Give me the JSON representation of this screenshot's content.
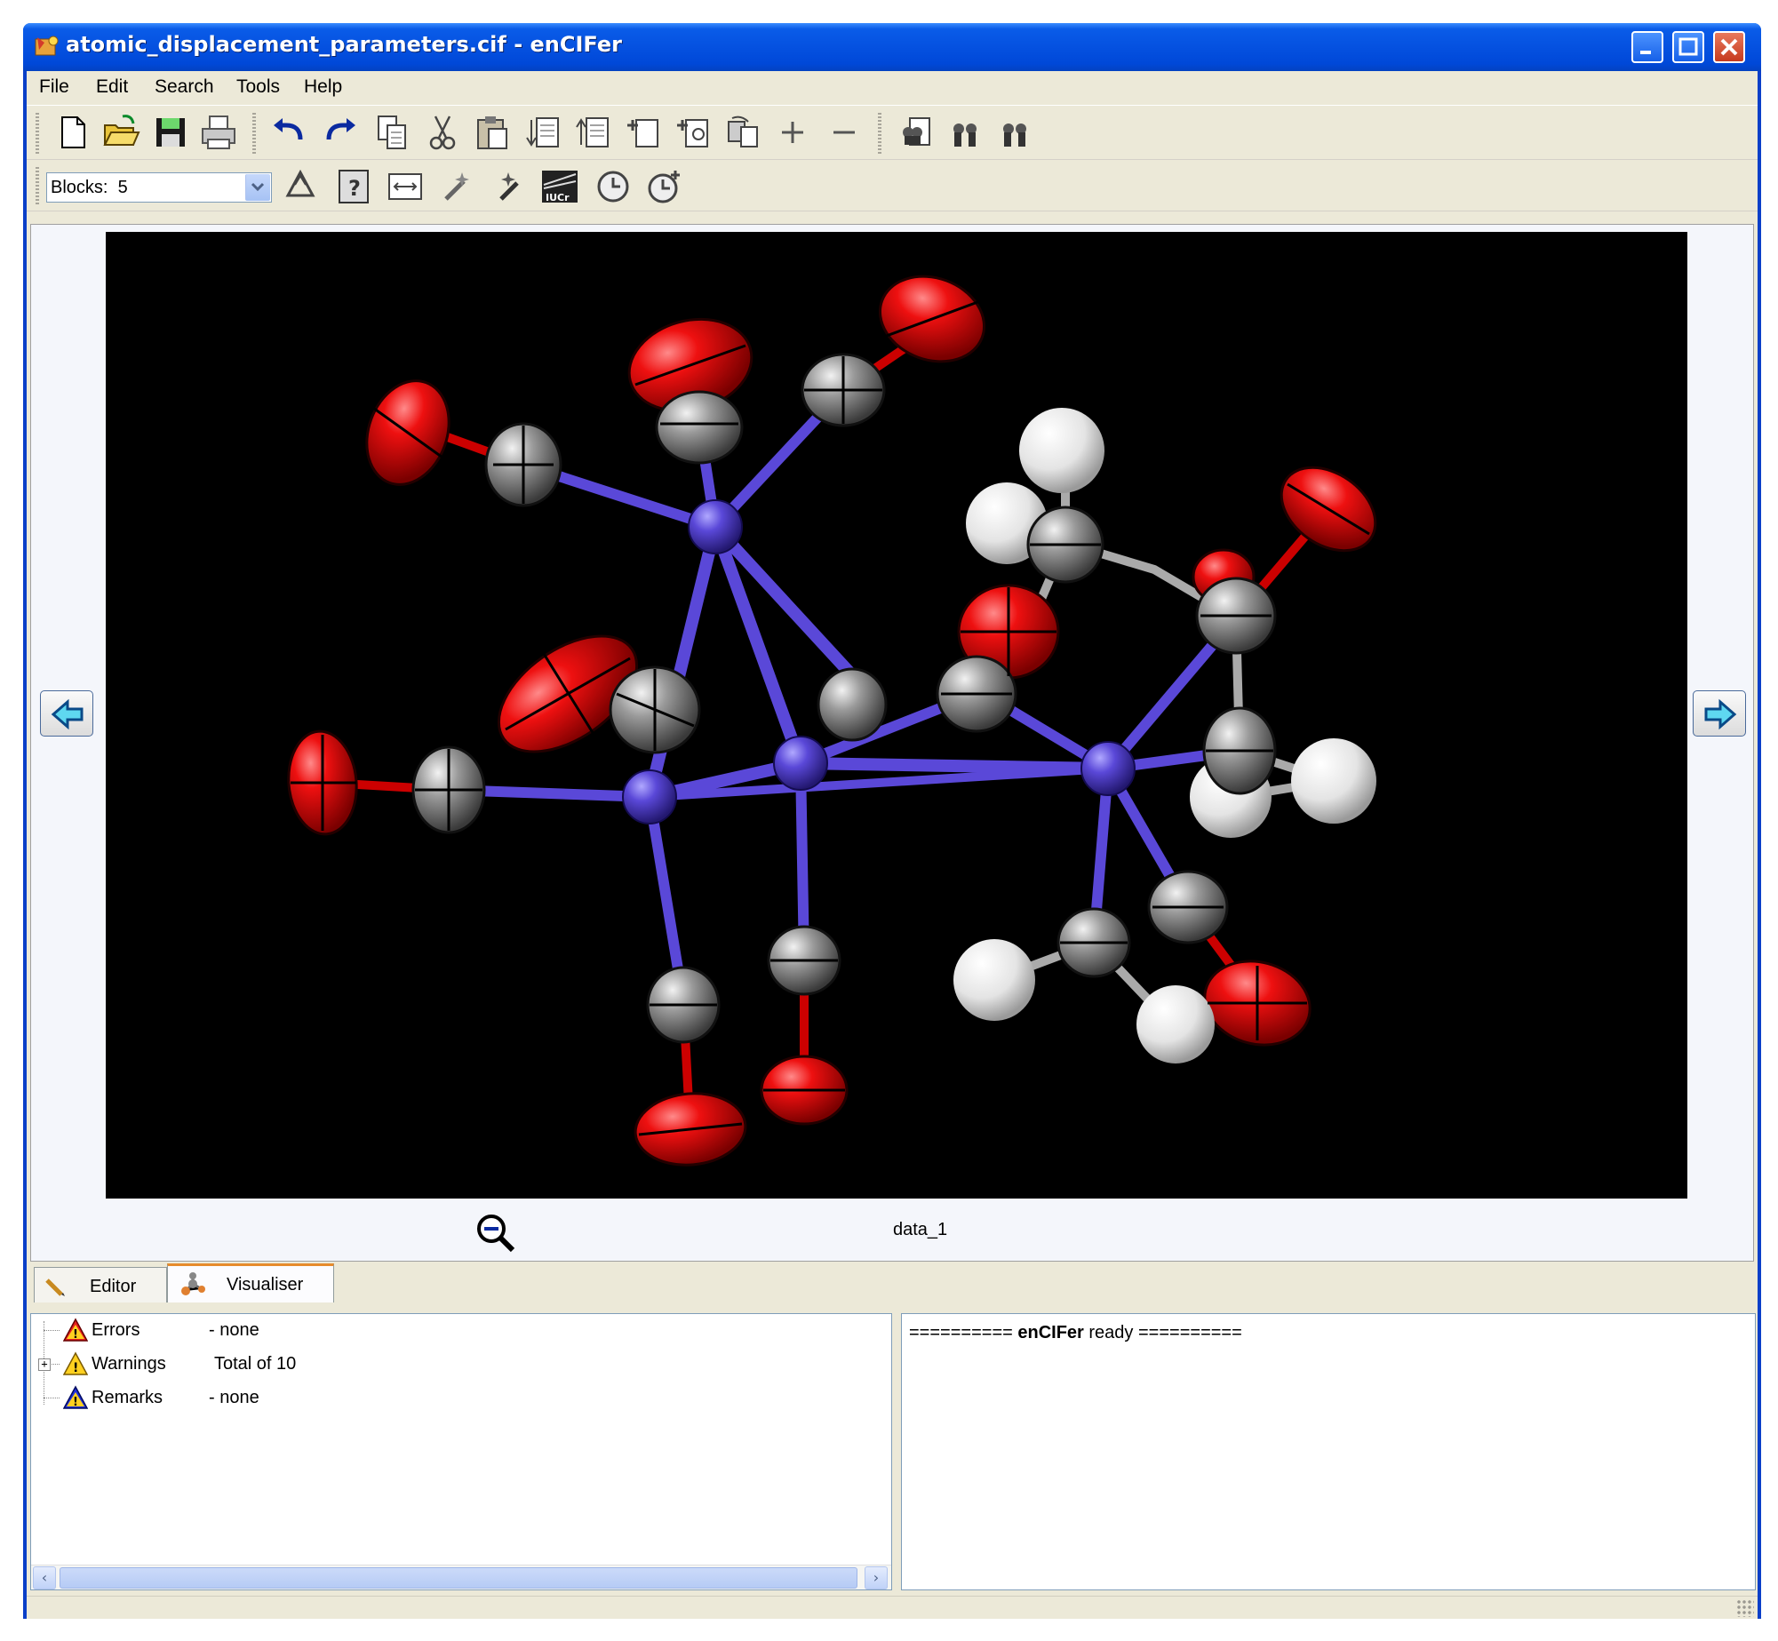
{
  "window": {
    "title": "atomic_displacement_parameters.cif - enCIFer"
  },
  "menu": {
    "items": [
      "File",
      "Edit",
      "Search",
      "Tools",
      "Help"
    ]
  },
  "toolbar": {
    "blocks_label": "Blocks:",
    "blocks_value": "5"
  },
  "viewer": {
    "block_name": "data_1"
  },
  "tabs": [
    "Editor",
    "Visualiser"
  ],
  "checks": {
    "rows": [
      {
        "name": "Errors",
        "value": "- none",
        "icon": "error-icon"
      },
      {
        "name": "Warnings",
        "value": "Total of 10",
        "icon": "warning-icon"
      },
      {
        "name": "Remarks",
        "value": "- none",
        "icon": "remark-icon"
      }
    ]
  },
  "log": {
    "prefix": "==========",
    "app": "enCIFer",
    "message": "ready",
    "suffix": "=========="
  },
  "colors": {
    "title_bar": "#0551e0",
    "viewer_background": "#000000",
    "metal_atoms": "#5a48d8",
    "oxygen_atoms": "#e00000",
    "carbon_atoms": "#8c8c8c",
    "hydrogen_atoms": "#f0f0f0",
    "active_tab_accent": "#e68b2c"
  }
}
